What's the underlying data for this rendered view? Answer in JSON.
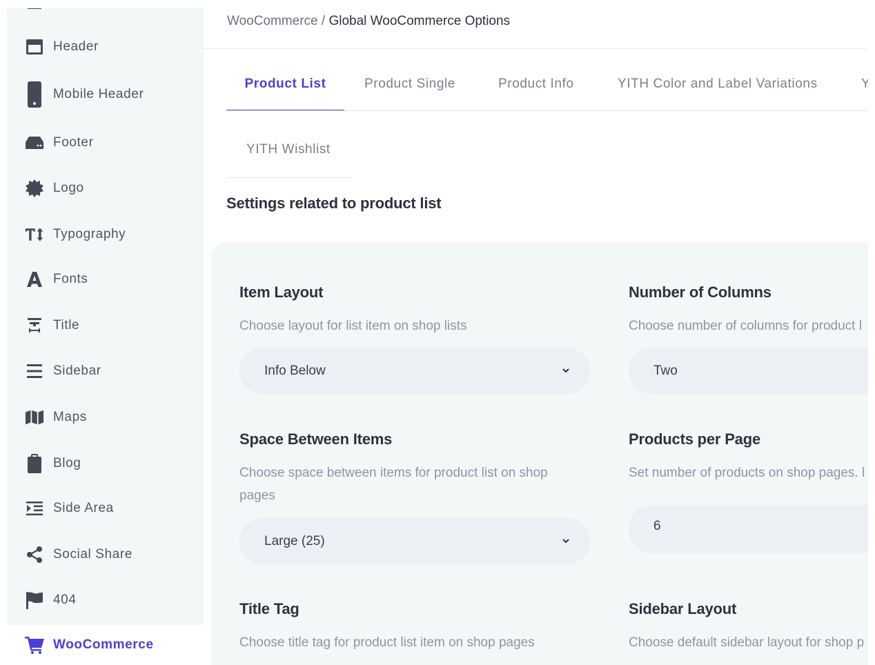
{
  "breadcrumb": {
    "parent": "WooCommerce / ",
    "current": "Global WooCommerce Options"
  },
  "sidebar": {
    "items": [
      {
        "label": "Header",
        "icon": "header-icon"
      },
      {
        "label": "Mobile Header",
        "icon": "mobile-icon"
      },
      {
        "label": "Footer",
        "icon": "footer-icon"
      },
      {
        "label": "Logo",
        "icon": "logo-icon"
      },
      {
        "label": "Typography",
        "icon": "typography-icon"
      },
      {
        "label": "Fonts",
        "icon": "fonts-icon"
      },
      {
        "label": "Title",
        "icon": "title-icon"
      },
      {
        "label": "Sidebar",
        "icon": "sidebar-icon"
      },
      {
        "label": "Maps",
        "icon": "maps-icon"
      },
      {
        "label": "Blog",
        "icon": "blog-icon"
      },
      {
        "label": "Side Area",
        "icon": "side-area-icon"
      },
      {
        "label": "Social Share",
        "icon": "share-icon"
      },
      {
        "label": "404",
        "icon": "flag-icon"
      }
    ],
    "active": {
      "label": "WooCommerce",
      "icon": "cart-icon"
    }
  },
  "tabs": [
    {
      "label": "Product List",
      "active": true
    },
    {
      "label": "Product Single"
    },
    {
      "label": "Product Info"
    },
    {
      "label": "YITH Color and Label Variations"
    },
    {
      "label": "Y"
    },
    {
      "label": "YITH Wishlist"
    }
  ],
  "section_title": "Settings related to product list",
  "fields": [
    {
      "title": "Item Layout",
      "desc": "Choose layout for list item on shop lists",
      "value": "Info Below"
    },
    {
      "title": "Number of Columns",
      "desc": "Choose number of columns for product l",
      "value": "Two"
    },
    {
      "title": "Space Between Items",
      "desc": "Choose space between items for product list on shop",
      "desc2": "pages",
      "value": "Large (25)"
    },
    {
      "title": "Products per Page",
      "desc": "Set number of products on shop pages. l",
      "value": "6"
    },
    {
      "title": "Title Tag",
      "desc": "Choose title tag for product list item on shop pages"
    },
    {
      "title": "Sidebar Layout",
      "desc": "Choose default sidebar layout for shop p"
    }
  ],
  "colors": {
    "accent": "#4b3fd6",
    "sidebar_bg": "#f2f8f7",
    "panel_bg": "#f2f8f7",
    "input_bg": "#eceff3"
  }
}
